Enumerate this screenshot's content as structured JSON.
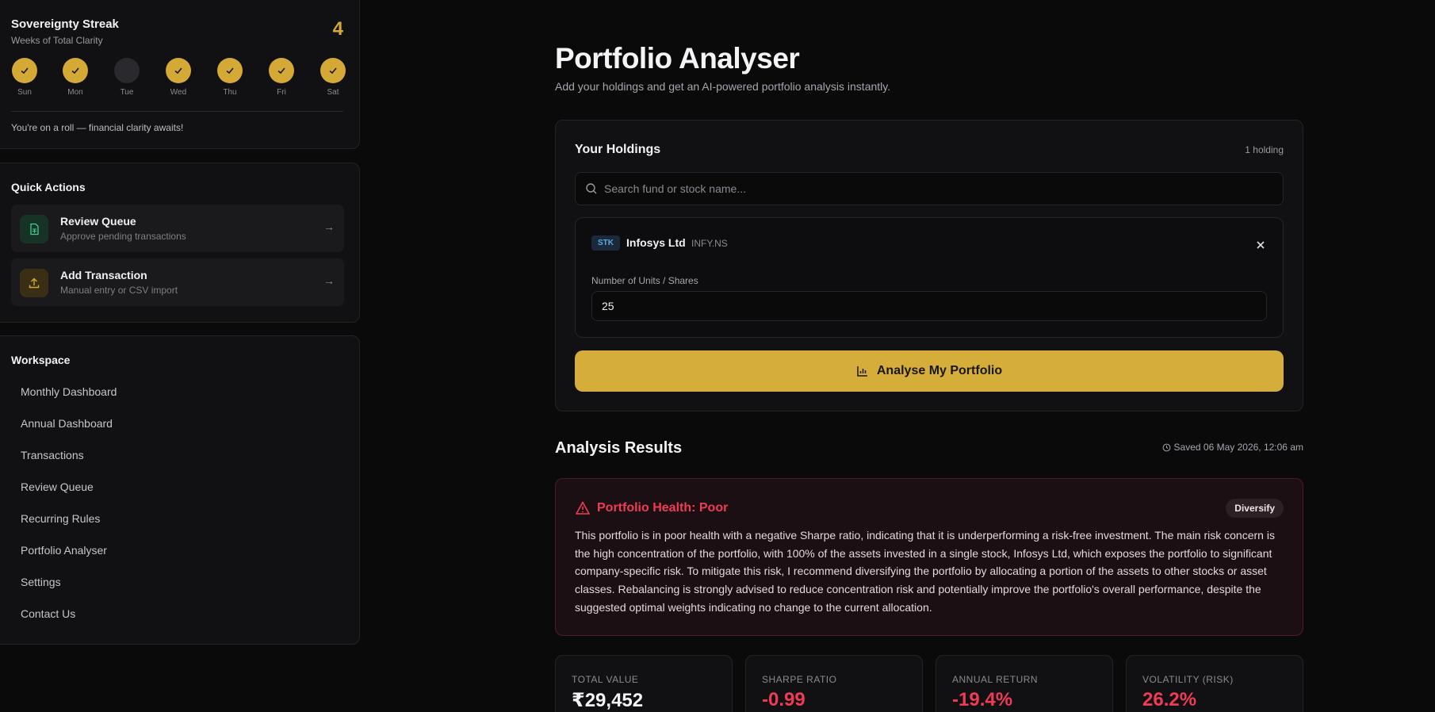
{
  "streak": {
    "title": "Sovereignty Streak",
    "subtitle": "Weeks of Total Clarity",
    "count": "4",
    "days": [
      {
        "label": "Sun",
        "done": true
      },
      {
        "label": "Mon",
        "done": true
      },
      {
        "label": "Tue",
        "done": false
      },
      {
        "label": "Wed",
        "done": true
      },
      {
        "label": "Thu",
        "done": true
      },
      {
        "label": "Fri",
        "done": true
      },
      {
        "label": "Sat",
        "done": true
      }
    ],
    "message": "You're on a roll — financial clarity awaits!"
  },
  "quick_actions": {
    "heading": "Quick Actions",
    "items": [
      {
        "title": "Review Queue",
        "subtitle": "Approve pending transactions",
        "icon": "document-icon"
      },
      {
        "title": "Add Transaction",
        "subtitle": "Manual entry or CSV import",
        "icon": "upload-icon"
      }
    ]
  },
  "workspace": {
    "heading": "Workspace",
    "items": [
      "Monthly Dashboard",
      "Annual Dashboard",
      "Transactions",
      "Review Queue",
      "Recurring Rules",
      "Portfolio Analyser",
      "Settings",
      "Contact Us"
    ]
  },
  "main": {
    "title": "Portfolio Analyser",
    "subtitle": "Add your holdings and get an AI-powered portfolio analysis instantly."
  },
  "holdings": {
    "heading": "Your Holdings",
    "count": "1 holding",
    "search_placeholder": "Search fund or stock name...",
    "item": {
      "type": "STK",
      "name": "Infosys Ltd",
      "ticker": "INFY.NS",
      "units_label": "Number of Units / Shares",
      "units_value": "25"
    },
    "analyse_label": "Analyse My Portfolio"
  },
  "results": {
    "heading": "Analysis Results",
    "saved": "Saved 06 May 2026, 12:06 am",
    "health_title": "Portfolio Health: Poor",
    "health_badge": "Diversify",
    "health_text": "This portfolio is in poor health with a negative Sharpe ratio, indicating that it is underperforming a risk-free investment. The main risk concern is the high concentration of the portfolio, with 100% of the assets invested in a single stock, Infosys Ltd, which exposes the portfolio to significant company-specific risk. To mitigate this risk, I recommend diversifying the portfolio by allocating a portion of the assets to other stocks or asset classes. Rebalancing is strongly advised to reduce concentration risk and potentially improve the portfolio's overall performance, despite the suggested optimal weights indicating no change to the current allocation."
  },
  "metrics": [
    {
      "label": "TOTAL VALUE",
      "value": "₹29,452"
    },
    {
      "label": "SHARPE RATIO",
      "value": "-0.99"
    },
    {
      "label": "ANNUAL RETURN",
      "value": "-19.4%"
    },
    {
      "label": "VOLATILITY (RISK)",
      "value": "26.2%"
    }
  ],
  "colors": {
    "accent": "#d4ad3a",
    "danger": "#ef3b55",
    "background": "#0a0a0b",
    "card": "#111113"
  }
}
